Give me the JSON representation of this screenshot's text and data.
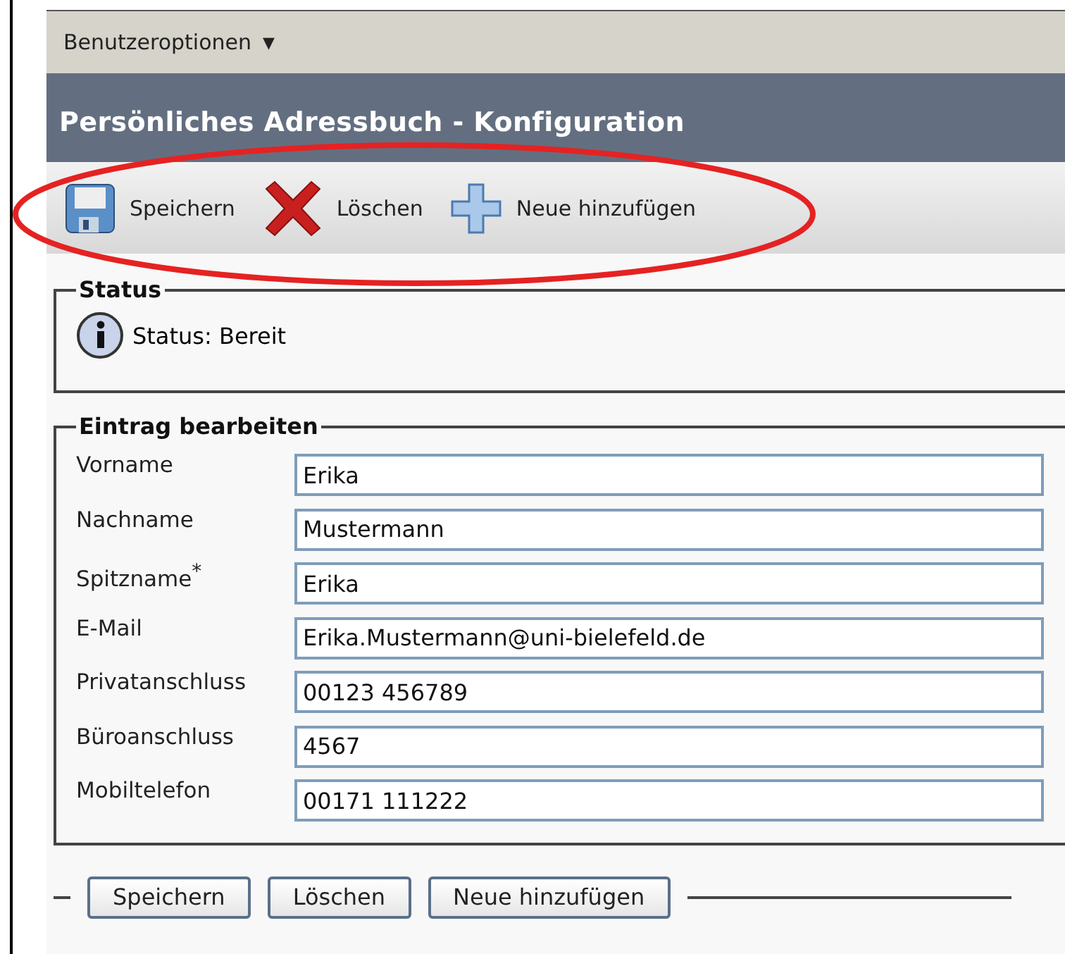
{
  "menu": {
    "label": "Benutzeroptionen",
    "caret": "▼"
  },
  "title": "Persönliches Adressbuch - Konfiguration",
  "toolbar": [
    {
      "kind": "save",
      "label": "Speichern"
    },
    {
      "kind": "delete",
      "label": "Löschen"
    },
    {
      "kind": "add",
      "label": "Neue hinzufügen"
    }
  ],
  "status": {
    "legend": "Status",
    "text": "Status: Bereit"
  },
  "entry": {
    "legend": "Eintrag bearbeiten",
    "fields": [
      {
        "label": "Vorname",
        "value": "Erika"
      },
      {
        "label": "Nachname",
        "value": "Mustermann"
      },
      {
        "label": "Spitzname$^{*}$",
        "value": "Erika"
      },
      {
        "label": "E-Mail",
        "value": "Erika.Mustermann@uni-bielefeld.de"
      },
      {
        "label": "Privatanschluss",
        "value": "00123 456789"
      },
      {
        "label": "Büroanschluss",
        "value": "4567"
      },
      {
        "label": "Mobiltelefon",
        "value": "00171 111222"
      }
    ]
  },
  "buttons": [
    "Speichern",
    "Löschen",
    "Neue hinzufügen"
  ]
}
